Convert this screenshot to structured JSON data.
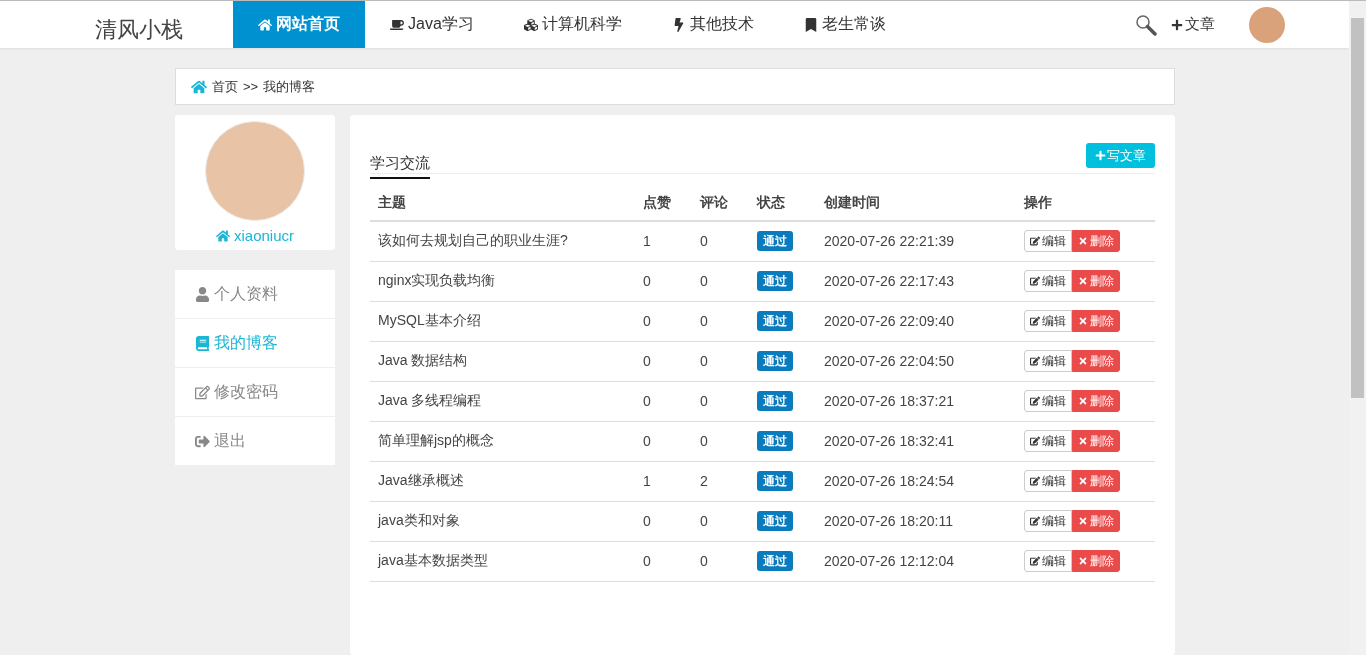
{
  "site": {
    "logo": "清风小栈"
  },
  "nav": [
    {
      "label": "网站首页",
      "selected": true
    },
    {
      "label": "Java学习",
      "selected": false
    },
    {
      "label": "计算机科学",
      "selected": false
    },
    {
      "label": "其他技术",
      "selected": false
    },
    {
      "label": "老生常谈",
      "selected": false
    }
  ],
  "header_actions": {
    "write": "文章"
  },
  "breadcrumb": {
    "home": "首页",
    "separator": ">>",
    "current": "我的博客"
  },
  "profile": {
    "username": "xiaoniucr"
  },
  "sidebar": {
    "items": [
      {
        "label": "个人资料",
        "selected": false
      },
      {
        "label": "我的博客",
        "selected": true
      },
      {
        "label": "修改密码",
        "selected": false
      },
      {
        "label": "退出",
        "selected": false
      }
    ]
  },
  "tabs": [
    {
      "label": "学习交流",
      "selected": true
    }
  ],
  "write_button": "写文章",
  "table": {
    "columns": [
      "主题",
      "点赞",
      "评论",
      "状态",
      "创建时间",
      "操作"
    ],
    "rows": [
      {
        "title": "该如何去规划自己的职业生涯?",
        "likes": "1",
        "comments": "0",
        "status": "通过",
        "created": "2020-07-26 22:21:39",
        "edit": "编辑",
        "delete": "删除"
      },
      {
        "title": "nginx实现负载均衡",
        "likes": "0",
        "comments": "0",
        "status": "通过",
        "created": "2020-07-26 22:17:43",
        "edit": "编辑",
        "delete": "删除"
      },
      {
        "title": "MySQL基本介绍",
        "likes": "0",
        "comments": "0",
        "status": "通过",
        "created": "2020-07-26 22:09:40",
        "edit": "编辑",
        "delete": "删除"
      },
      {
        "title": "Java 数据结构",
        "likes": "0",
        "comments": "0",
        "status": "通过",
        "created": "2020-07-26 22:04:50",
        "edit": "编辑",
        "delete": "删除"
      },
      {
        "title": "Java 多线程编程",
        "likes": "0",
        "comments": "0",
        "status": "通过",
        "created": "2020-07-26 18:37:21",
        "edit": "编辑",
        "delete": "删除"
      },
      {
        "title": "简单理解jsp的概念",
        "likes": "0",
        "comments": "0",
        "status": "通过",
        "created": "2020-07-26 18:32:41",
        "edit": "编辑",
        "delete": "删除"
      },
      {
        "title": "Java继承概述",
        "likes": "1",
        "comments": "2",
        "status": "通过",
        "created": "2020-07-26 18:24:54",
        "edit": "编辑",
        "delete": "删除"
      },
      {
        "title": "java类和对象",
        "likes": "0",
        "comments": "0",
        "status": "通过",
        "created": "2020-07-26 18:20:11",
        "edit": "编辑",
        "delete": "删除"
      },
      {
        "title": "java基本数据类型",
        "likes": "0",
        "comments": "0",
        "status": "通过",
        "created": "2020-07-26 12:12:04",
        "edit": "编辑",
        "delete": "删除"
      }
    ]
  }
}
